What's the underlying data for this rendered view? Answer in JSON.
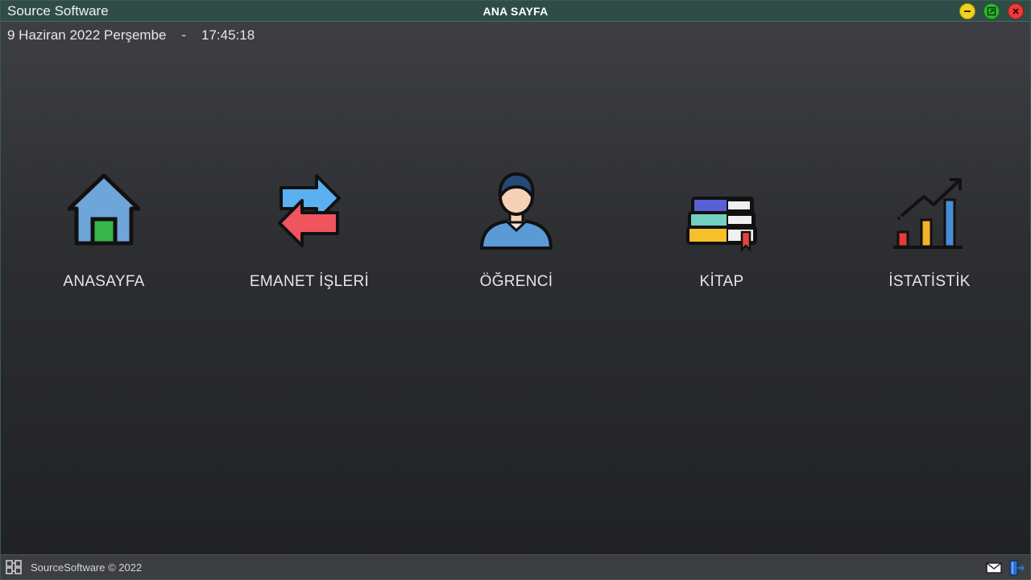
{
  "window": {
    "app_name": "Source Software",
    "title": "ANA SAYFA",
    "controls": [
      "minimize-icon",
      "maximize-icon",
      "close-icon"
    ]
  },
  "status": {
    "date": "9 Haziran 2022 Perşembe",
    "separator": "-",
    "time": "17:45:18"
  },
  "menu": {
    "items": [
      {
        "label": "ANASAYFA",
        "icon": "house-icon"
      },
      {
        "label": "EMANET İŞLERİ",
        "icon": "exchange-arrows-icon"
      },
      {
        "label": "ÖĞRENCİ",
        "icon": "student-icon"
      },
      {
        "label": "KİTAP",
        "icon": "books-icon"
      },
      {
        "label": "İSTATİSTİK",
        "icon": "bar-chart-icon"
      }
    ]
  },
  "footer": {
    "copyright": "SourceSoftware © 2022",
    "icons": [
      "logo-icon",
      "mail-icon",
      "exit-icon"
    ]
  },
  "colors": {
    "titlebar": "#2f4d46",
    "footer": "#3d3e41",
    "minimize": "#f4d21c",
    "maximize": "#2fb82f",
    "close": "#ee3a3a"
  }
}
